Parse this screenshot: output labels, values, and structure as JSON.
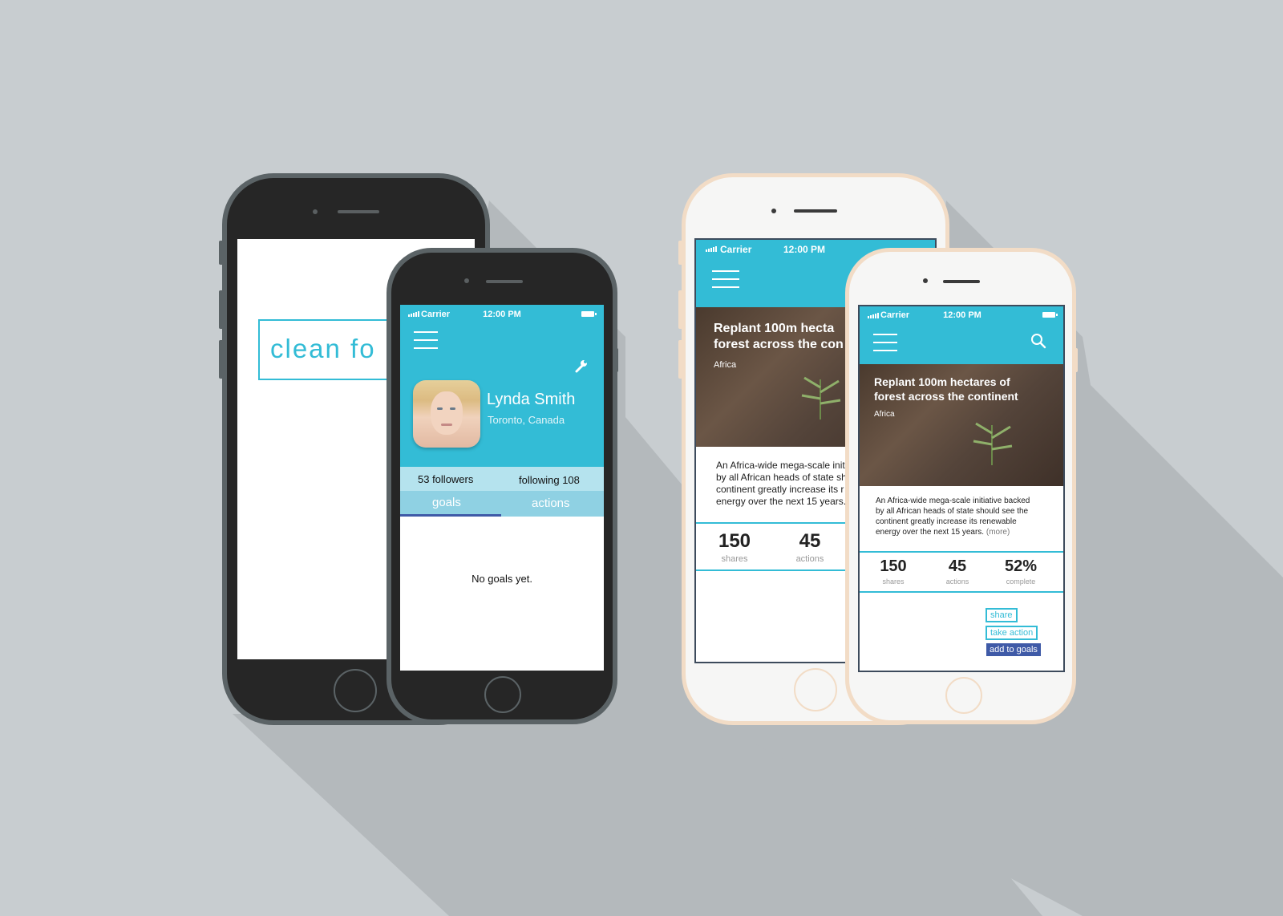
{
  "background": "#c8cdd0",
  "accent": "#33bcd6",
  "splash": {
    "logo_text": "clean fo"
  },
  "profile": {
    "carrier": "Carrier",
    "time": "12:00 PM",
    "settings_icon": "wrench-icon",
    "user_name": "Lynda Smith",
    "user_location": "Toronto, Canada",
    "followers": "53 followers",
    "following": "following 108",
    "tabs": [
      {
        "label": "goals",
        "active": true
      },
      {
        "label": "actions",
        "active": false
      }
    ],
    "empty_message": "No goals yet."
  },
  "article_back": {
    "carrier": "Carrier",
    "time": "12:00 PM",
    "title_line1": "Replant 100m hecta",
    "title_line2": "forest across the con",
    "region": "Africa",
    "body_lines": [
      "An Africa-wide mega-scale initi",
      "by all African heads of state sh",
      "continent greatly increase its r",
      "energy over the next 15 years."
    ],
    "stats": [
      {
        "value": "150",
        "label": "shares"
      },
      {
        "value": "45",
        "label": "actions"
      }
    ]
  },
  "article": {
    "carrier": "Carrier",
    "time": "12:00 PM",
    "search_icon": "search-icon",
    "title_line1": "Replant 100m hectares of",
    "title_line2": "forest across the continent",
    "region": "Africa",
    "body_lines": [
      "An Africa-wide mega-scale initiative backed",
      "by all African heads of state should see the",
      "continent greatly increase its renewable"
    ],
    "body_last": "energy over the next 15 years.",
    "more_link": "(more)",
    "stats": [
      {
        "value": "150",
        "label": "shares"
      },
      {
        "value": "45",
        "label": "actions"
      },
      {
        "value": "52%",
        "label": "complete"
      }
    ],
    "buttons": {
      "share": "share",
      "take_action": "take action",
      "add_to_goals": "add to goals"
    }
  }
}
